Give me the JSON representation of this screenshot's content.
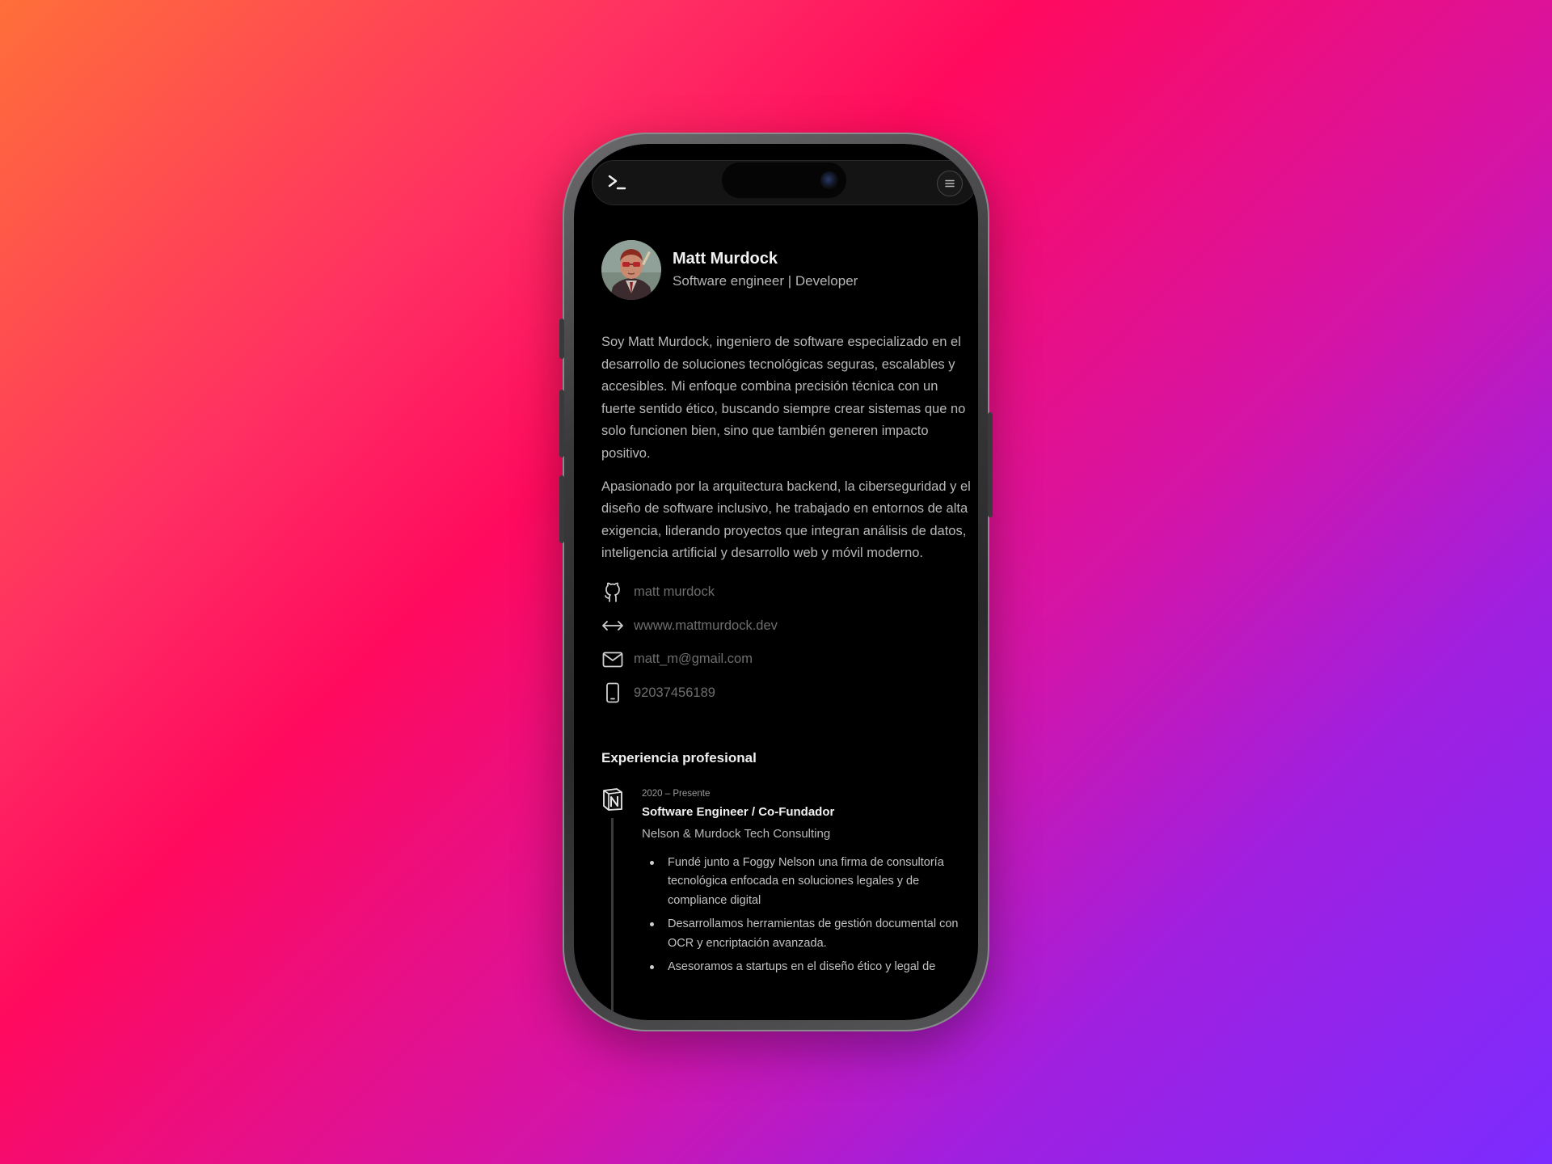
{
  "profile": {
    "name": "Matt Murdock",
    "role": "Software engineer | Developer"
  },
  "bio": {
    "paragraph_1": "Soy Matt Murdock, ingeniero de software especializado en el desarrollo de soluciones tecnológicas seguras, escalables y accesibles. Mi enfoque combina precisión técnica con un fuerte sentido ético, buscando siempre crear sistemas que no solo funcionen bien, sino que también generen impacto positivo.",
    "paragraph_2": "Apasionado por la arquitectura backend, la ciberseguridad y el diseño de software inclusivo, he trabajado en entornos de alta exigencia, liderando proyectos que integran análisis de datos, inteligencia artificial y desarrollo web y móvil moderno."
  },
  "contacts": {
    "github": "matt murdock",
    "website": "wwww.mattmurdock.dev",
    "email": "matt_m@gmail.com",
    "phone": "92037456189"
  },
  "experience_section": {
    "title": "Experiencia profesional",
    "item": {
      "dates": "2020 – Presente",
      "title": "Software Engineer / Co-Fundador",
      "company": "Nelson & Murdock Tech Consulting",
      "bullets": [
        "Fundé junto a Foggy Nelson una firma de consultoría tecnológica enfocada en soluciones legales y de compliance digital",
        "Desarrollamos herramientas de gestión documental con OCR y encriptación avanzada.",
        "Asesoramos a startups en el diseño ético y legal de"
      ]
    }
  },
  "colors": {
    "screen_background": "#000000",
    "muted_link": "#6e6e6e"
  },
  "icons": {
    "terminal": "terminal-icon",
    "menu": "menu-icon",
    "github": "github-icon",
    "website": "code-arrows-icon",
    "email": "mail-icon",
    "phone": "phone-icon",
    "company_logo": "notion-logo-icon"
  }
}
